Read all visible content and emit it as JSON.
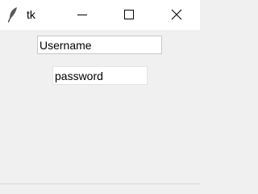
{
  "window": {
    "title": "tk",
    "app_icon": "feather-icon",
    "controls": {
      "minimize_icon": "minimize-icon",
      "maximize_icon": "maximize-icon",
      "close_icon": "close-icon"
    }
  },
  "form": {
    "username": {
      "value": "Username"
    },
    "password": {
      "value": "password"
    }
  },
  "colors": {
    "titlebar_bg": "#ffffff",
    "client_bg": "#f0f0f0",
    "field_bg": "#ffffff",
    "field_border": "#d2d2d2",
    "text": "#000000"
  }
}
